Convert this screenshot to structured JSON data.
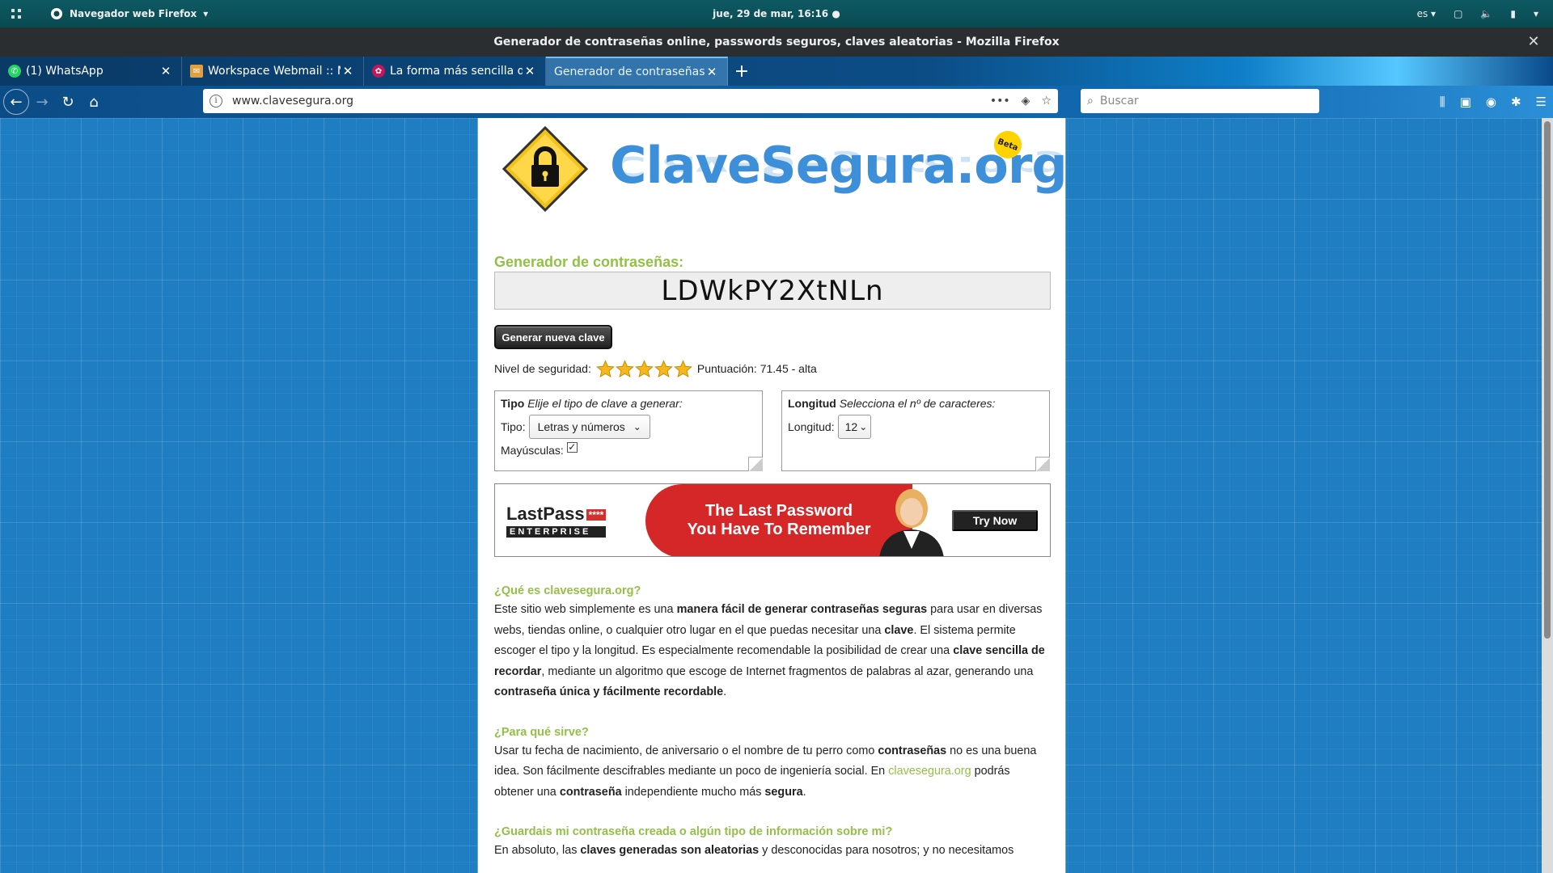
{
  "system": {
    "app_menu": "Navegador web Firefox",
    "clock": "jue, 29 de mar, 16:16",
    "lang": "es"
  },
  "window": {
    "title": "Generador de contraseñas online, passwords seguros, claves aleatorias - Mozilla Firefox"
  },
  "tabs": [
    {
      "label": "(1) WhatsApp",
      "favicon_color": "#25d366",
      "active": false
    },
    {
      "label": "Workspace Webmail :: M",
      "favicon_color": "#e0a040",
      "active": false
    },
    {
      "label": "La forma más sencilla de",
      "favicon_color": "#c2185b",
      "active": false
    },
    {
      "label": "Generador de contraseñas o",
      "favicon_color": "#3e8fd9",
      "active": true
    }
  ],
  "navbar": {
    "url": "www.clavesegura.org",
    "search_placeholder": "Buscar"
  },
  "page": {
    "brand": "ClaveSegura.org",
    "beta_badge": "Beta",
    "generator_title": "Generador de contraseñas:",
    "password": "LDWkPY2XtNLn",
    "generate_button": "Generar nueva clave",
    "security_label": "Nivel de seguridad:",
    "stars_filled": 5,
    "stars_total": 5,
    "score_text": "Puntuación: 71.45 - alta",
    "tipo_box": {
      "title": "Tipo",
      "subtitle": "Elije el tipo de clave a generar:",
      "tipo_label": "Tipo:",
      "tipo_value": "Letras y números",
      "mayus_label": "Mayúsculas:",
      "mayus_checked": true
    },
    "longitud_box": {
      "title": "Longitud",
      "subtitle": "Selecciona el nº de caracteres:",
      "longitud_label": "Longitud:",
      "longitud_value": "12"
    },
    "ad": {
      "brand": "LastPass",
      "brand_stars": "****",
      "brand_sub": "ENTERPRISE",
      "headline_1": "The Last Password",
      "headline_2": "You Have To Remember",
      "cta": "Try Now"
    },
    "sections": {
      "q1_title": "¿Qué es clavesegura.org?",
      "q1_t1": "Este sitio web simplemente es una ",
      "q1_b1": "manera fácil de generar contraseñas seguras",
      "q1_t2": " para usar en diversas webs, tiendas online, o cualquier otro lugar en el que puedas necesitar una ",
      "q1_b2": "clave",
      "q1_t3": ". El sistema permite escoger el tipo y la longitud. Es especialmente recomendable la posibilidad de crear una ",
      "q1_b3": "clave sencilla de recordar",
      "q1_t4": ", mediante un algoritmo que escoge de Internet fragmentos de palabras al azar, generando una ",
      "q1_b4": "contraseña única y fácilmente recordable",
      "q1_t5": ".",
      "q2_title": "¿Para qué sirve?",
      "q2_t1": "Usar tu fecha de nacimiento, de aniversario o el nombre de tu perro como ",
      "q2_b1": "contraseñas",
      "q2_t2": " no es una buena idea. Son fácilmente descifrables mediante un poco de ingeniería social. En ",
      "q2_link": "clavesegura.org",
      "q2_t3": " podrás obtener una ",
      "q2_b2": "contraseña",
      "q2_t4": " independiente mucho más ",
      "q2_b3": "segura",
      "q2_t5": ".",
      "q3_title": "¿Guardais mi contraseña creada o algún tipo de información sobre mi?",
      "q3_t1": "En absoluto, las ",
      "q3_b1": "claves generadas son aleatorias",
      "q3_t2": " y desconocidas para nosotros; y no necesitamos"
    }
  }
}
